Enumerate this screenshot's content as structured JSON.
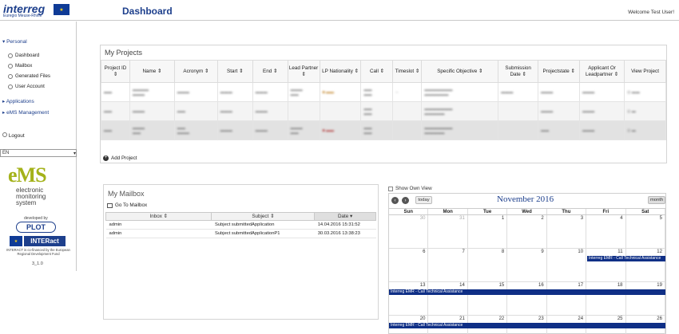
{
  "header": {
    "logo_text": "interreg",
    "logo_subtext": "Euregio Meuse-Rhine",
    "page_title": "Dashboard",
    "welcome": "Welcome Test User!"
  },
  "sidebar": {
    "sections": [
      {
        "label": "Personal"
      },
      {
        "label": "Applications"
      },
      {
        "label": "eMS Management"
      }
    ],
    "personal_items": [
      {
        "label": "Dashboard"
      },
      {
        "label": "Mailbox"
      },
      {
        "label": "Generated Files"
      },
      {
        "label": "User Account"
      }
    ],
    "logout": "Logout",
    "language": "EN",
    "ems_logo": "eMS",
    "ems_line1": "electronic",
    "ems_line2": "monitoring",
    "ems_line3": "system",
    "developed_by": "developed by",
    "plot": "PLOT",
    "interact": "INTERact",
    "interact_note": "INTERACT is co-financed by the European Regional Development Fund",
    "version": "3_1.0"
  },
  "projects": {
    "title": "My Projects",
    "columns": [
      "Project ID",
      "Name",
      "Acronym",
      "Start",
      "End",
      "Lead Partner",
      "LP Nationality",
      "Call",
      "Timeslot",
      "Specific Objective",
      "Submission Date",
      "Projectstate",
      "Applicant Or Leadpartner",
      "View Project"
    ],
    "add_label": "Add Project"
  },
  "mailbox": {
    "title": "My Mailbox",
    "goto": "Go To Mailbox",
    "columns": [
      "Inbox",
      "Subject",
      "Date"
    ],
    "rows": [
      {
        "inbox": "admin",
        "subject": "Subject submittedApplication",
        "date": "14.04.2016 15:31:52"
      },
      {
        "inbox": "admin",
        "subject": "Subject submittedApplicationP1",
        "date": "30.03.2016 13:38:23"
      }
    ]
  },
  "calendar": {
    "own_view": "Show Own View",
    "title": "November 2016",
    "today": "today",
    "month": "month",
    "days": [
      "Sun",
      "Mon",
      "Tue",
      "Wed",
      "Thu",
      "Fri",
      "Sat"
    ],
    "weeks": [
      [
        "30",
        "31",
        "1",
        "2",
        "3",
        "4",
        "5"
      ],
      [
        "6",
        "7",
        "8",
        "9",
        "10",
        "11",
        "12"
      ],
      [
        "13",
        "14",
        "15",
        "16",
        "17",
        "18",
        "19"
      ],
      [
        "20",
        "21",
        "22",
        "23",
        "24",
        "25",
        "26"
      ]
    ],
    "event_label": "Interreg EMR - Call Technical Assistance"
  }
}
